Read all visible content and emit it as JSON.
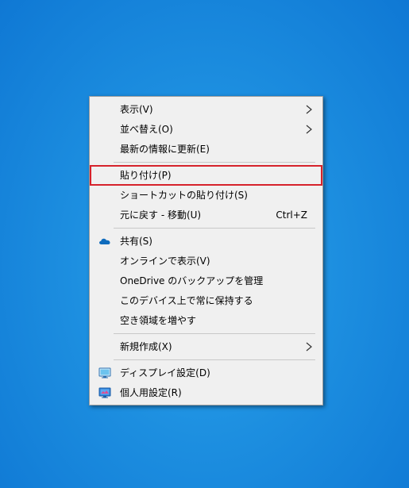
{
  "context_menu": {
    "items": [
      {
        "label": "表示(V)"
      },
      {
        "label": "並べ替え(O)"
      },
      {
        "label": "最新の情報に更新(E)"
      },
      {
        "label": "貼り付け(P)"
      },
      {
        "label": "ショートカットの貼り付け(S)"
      },
      {
        "label": "元に戻す - 移動(U)",
        "shortcut": "Ctrl+Z"
      },
      {
        "label": "共有(S)",
        "icon": "onedrive-cloud-icon"
      },
      {
        "label": "オンラインで表示(V)"
      },
      {
        "label": "OneDrive のバックアップを管理"
      },
      {
        "label": "このデバイス上で常に保持する"
      },
      {
        "label": "空き領域を増やす"
      },
      {
        "label": "新規作成(X)"
      },
      {
        "label": "ディスプレイ設定(D)",
        "icon": "display-settings-icon"
      },
      {
        "label": "個人用設定(R)",
        "icon": "personalize-icon"
      }
    ]
  },
  "colors": {
    "desktop": "#1d8fe0",
    "menu_bg": "#f0f0f0",
    "highlight_border": "#d6222b",
    "onedrive_blue": "#0f6cbd"
  }
}
